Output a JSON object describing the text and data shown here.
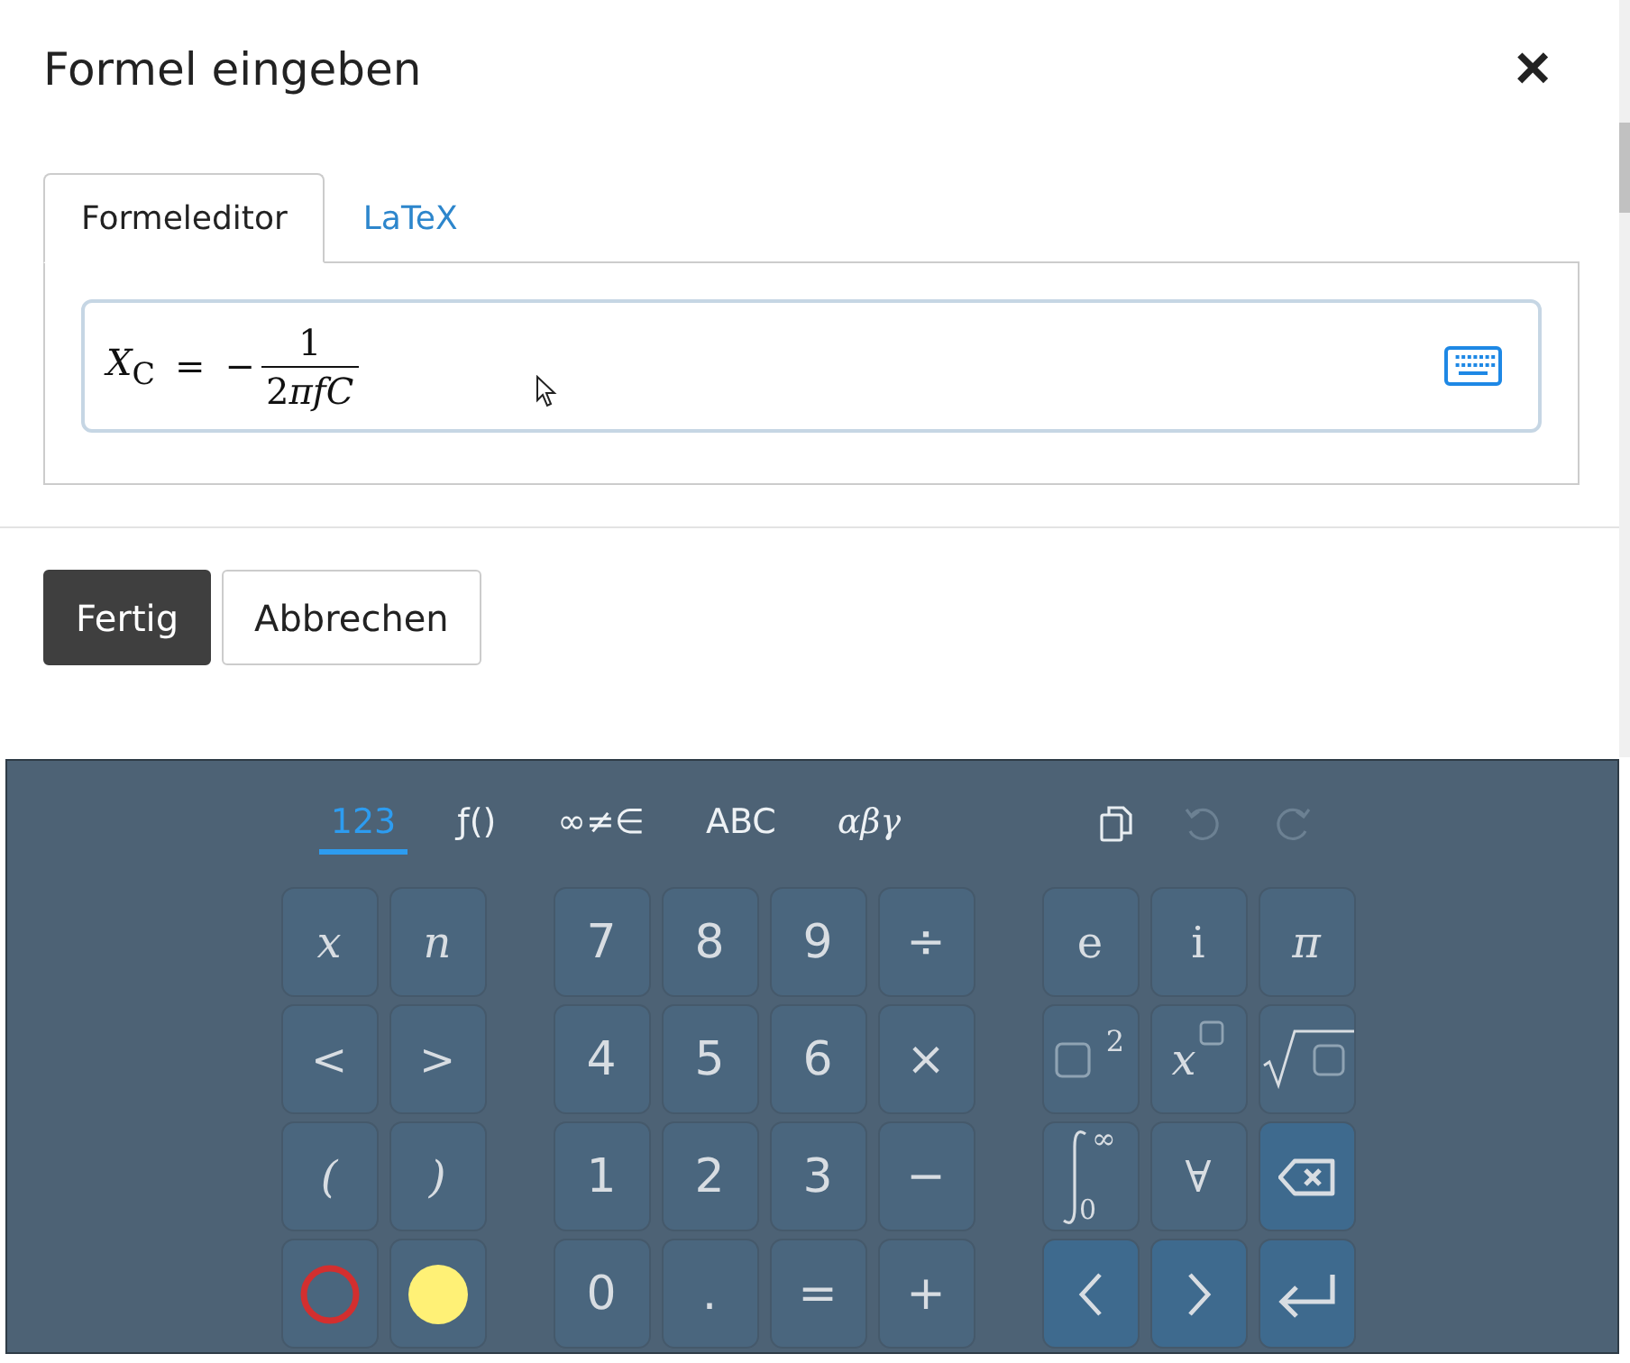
{
  "dialog": {
    "title": "Formel eingeben",
    "close": "×"
  },
  "tabs": [
    {
      "label": "Formeleditor",
      "selected": true
    },
    {
      "label": "LaTeX",
      "selected": false
    }
  ],
  "formula": {
    "lhs": "*X*$_{C}$",
    "relation": "=",
    "sign": "−",
    "numerator": "1",
    "denominator": {
      "number": "2",
      "symbols": "πfC"
    }
  },
  "buttons": [
    {
      "label": "Fertig",
      "kind": "primary"
    },
    {
      "label": "Abbrechen",
      "kind": "secondary"
    }
  ],
  "keyboard": {
    "tabs": [
      {
        "label": "123",
        "selected": true,
        "kind": "plain"
      },
      {
        "label": "ƒ()",
        "selected": false,
        "kind": "plain"
      },
      {
        "label": "∞≠∈",
        "selected": false,
        "kind": "plain"
      },
      {
        "label": "ABC",
        "selected": false,
        "kind": "plain"
      },
      {
        "label": "αβγ",
        "selected": false,
        "kind": "italic"
      }
    ],
    "tools": [
      {
        "kind": "copy",
        "disabled": false
      },
      {
        "kind": "undo",
        "disabled": true
      },
      {
        "kind": "redo",
        "disabled": true
      }
    ],
    "groups": [
      [
        {
          "kind": "math",
          "label": "x"
        },
        {
          "kind": "math",
          "label": "n"
        },
        {
          "kind": "math",
          "label": "<"
        },
        {
          "kind": "math",
          "label": ">"
        },
        {
          "kind": "math",
          "label": "("
        },
        {
          "kind": "math",
          "label": ")"
        },
        {
          "kind": "red-ring"
        },
        {
          "kind": "yellow-dot"
        }
      ],
      [
        {
          "kind": "text",
          "label": "7"
        },
        {
          "kind": "text",
          "label": "8"
        },
        {
          "kind": "text",
          "label": "9"
        },
        {
          "kind": "text",
          "label": "÷"
        },
        {
          "kind": "text",
          "label": "4"
        },
        {
          "kind": "text",
          "label": "5"
        },
        {
          "kind": "text",
          "label": "6"
        },
        {
          "kind": "text",
          "label": "×"
        },
        {
          "kind": "text",
          "label": "1"
        },
        {
          "kind": "text",
          "label": "2"
        },
        {
          "kind": "text",
          "label": "3"
        },
        {
          "kind": "text",
          "label": "−"
        },
        {
          "kind": "text",
          "label": "0"
        },
        {
          "kind": "text",
          "label": "."
        },
        {
          "kind": "text",
          "label": "="
        },
        {
          "kind": "text",
          "label": "+"
        }
      ],
      [
        {
          "kind": "serif",
          "label": "e"
        },
        {
          "kind": "serif",
          "label": "i"
        },
        {
          "kind": "math",
          "label": "π"
        },
        {
          "kind": "square-power",
          "label": "2"
        },
        {
          "kind": "power",
          "label": "x"
        },
        {
          "kind": "sqrt"
        },
        {
          "kind": "integral",
          "upper": "∞",
          "lower": "0"
        },
        {
          "kind": "serif",
          "label": "∀"
        },
        {
          "kind": "backspace"
        },
        {
          "kind": "left"
        },
        {
          "kind": "right"
        },
        {
          "kind": "enter"
        }
      ]
    ]
  }
}
